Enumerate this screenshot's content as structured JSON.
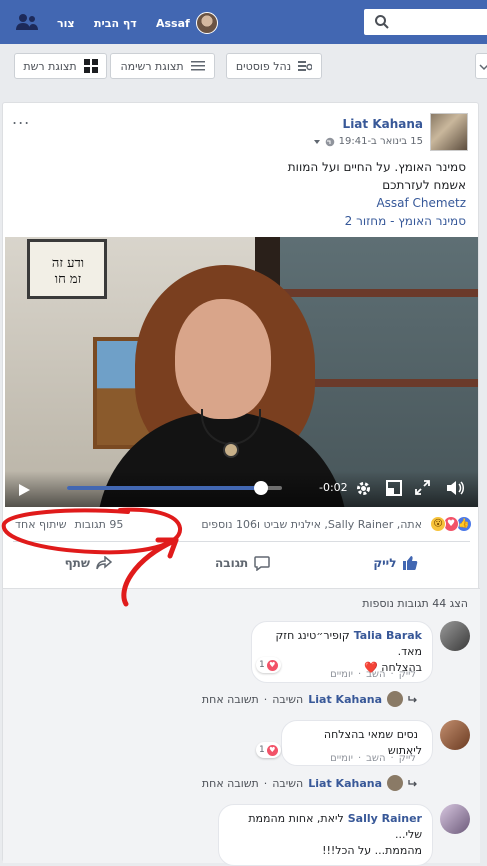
{
  "topbar": {
    "profile_name": "Assaf",
    "home_label": "דף הבית",
    "create_label": "צור",
    "search_icon": "search-icon",
    "friends_icon": "friends-icon"
  },
  "subbar": {
    "manage_posts": "נהל פוסטים",
    "list_view": "תצוגת רשימה",
    "grid_view": "תצוגת רשת"
  },
  "post": {
    "author": "Liat Kahana",
    "timestamp": "15 בינואר ב-19:41",
    "lines": [
      "סמינר האומץ. על החיים ועל המוות",
      "אשמח לעזרתכם"
    ],
    "mention": "Assaf Chemetz",
    "last_line": "סמינר האומץ - מחזור 2",
    "more": "..."
  },
  "video": {
    "sign_text": "ודע זה\nזמ חו",
    "time_remaining": "-0:02",
    "progress": 0.9
  },
  "reactions": {
    "reactors_text": "אתה, Sally Rainer, אילנית שביט ו106 נוספים",
    "comments_count": "95 תגובות",
    "shares_count": "שיתוף אחד"
  },
  "actions": {
    "like": "לייק",
    "comment": "תגובה",
    "share": "שתף"
  },
  "comments": {
    "more_comments": "הצג 44 תגובות נוספות",
    "items": [
      {
        "name": "Talia Barak",
        "text_line1": "קופיר״טינג חזק מאד.",
        "text_line2": "בהצלחה ❤️",
        "like": "לייק",
        "reply": "השב",
        "time": "יומיים",
        "reaction_count": "1",
        "reply_author": "Liat Kahana",
        "reply_verb": "השיבה",
        "reply_count": "תשובה אחת"
      },
      {
        "name": "",
        "text_line1": "נסים שמאי בהצלחה ליאתוש",
        "like": "לייק",
        "reply": "השב",
        "time": "יומיים",
        "reaction_count": "1",
        "reply_author": "Liat Kahana",
        "reply_verb": "השיבה",
        "reply_count": "תשובה אחת"
      },
      {
        "name": "Sally Rainer",
        "text_line1": "ליאת, אחות מהממת שלי...",
        "text_line2": "מהממת... על הכל!!!"
      }
    ]
  },
  "colors": {
    "brand": "#4267b2",
    "link": "#385898",
    "annotation": "#e01b1b"
  }
}
